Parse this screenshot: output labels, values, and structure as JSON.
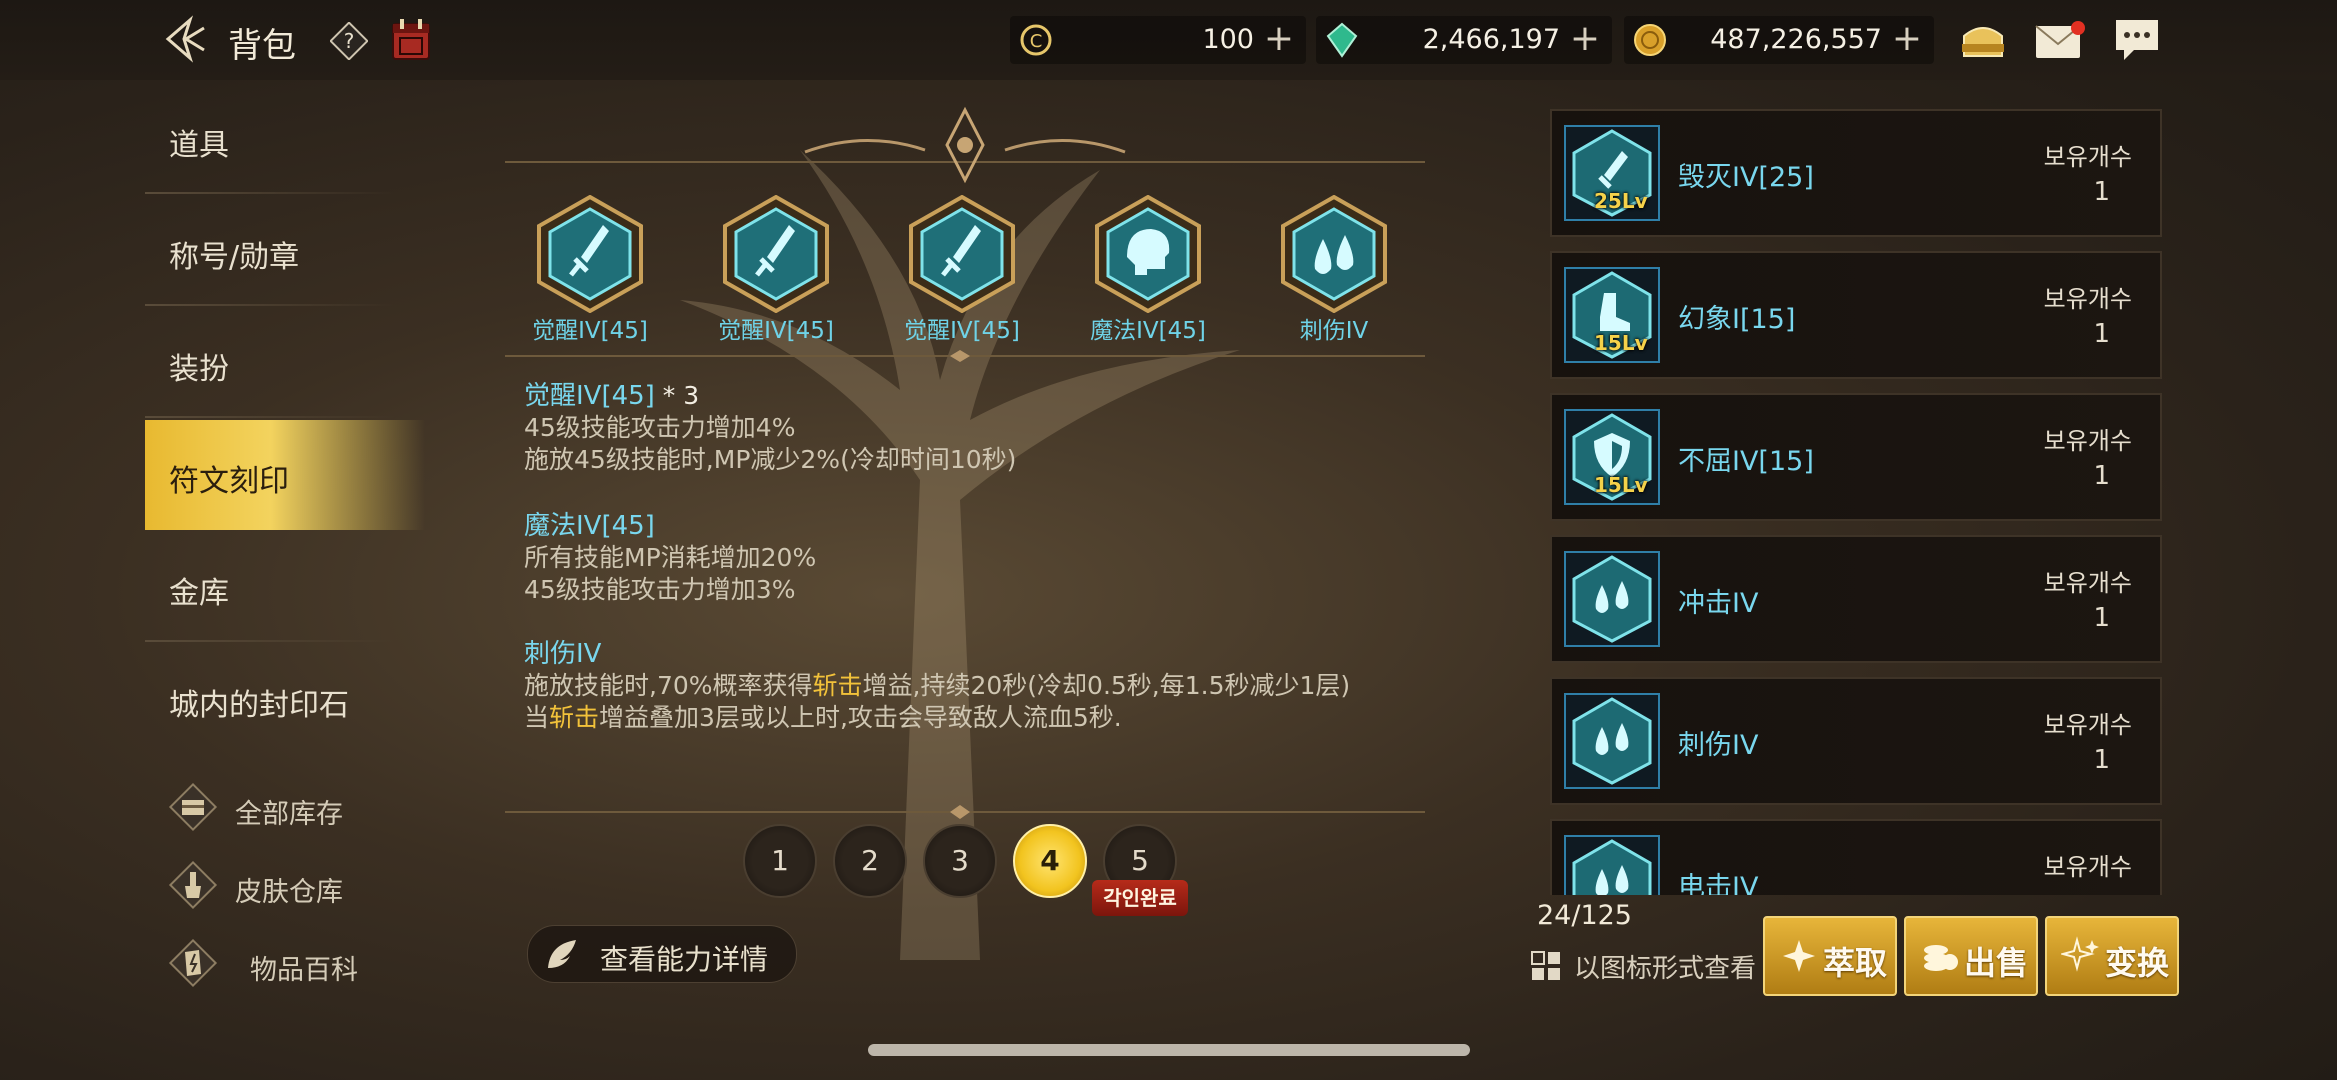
{
  "header": {
    "title": "背包",
    "currencies": [
      {
        "name": "crystal-c-currency",
        "value": "100"
      },
      {
        "name": "green-gem-currency",
        "value": "2,466,197"
      },
      {
        "name": "gold-coin-currency",
        "value": "487,226,557"
      }
    ],
    "plus_label": "+"
  },
  "sidebar": {
    "items": [
      {
        "label": "道具"
      },
      {
        "label": "称号/勋章"
      },
      {
        "label": "装扮"
      },
      {
        "label": "符文刻印"
      },
      {
        "label": "金库"
      },
      {
        "label": "城内的封印石"
      }
    ],
    "links": [
      {
        "label": "全部库存"
      },
      {
        "label": "皮肤仓库"
      },
      {
        "label": "物品百科"
      }
    ]
  },
  "slots": [
    {
      "name": "觉醒IV[45]",
      "icon": "sword-icon"
    },
    {
      "name": "觉醒IV[45]",
      "icon": "sword-icon"
    },
    {
      "name": "觉醒IV[45]",
      "icon": "sword-icon"
    },
    {
      "name": "魔法IV[45]",
      "icon": "head-icon"
    },
    {
      "name": "刺伤IV",
      "icon": "drops-icon"
    }
  ],
  "effects": [
    {
      "title": "觉醒IV[45]",
      "mult": " * 3",
      "line1": "45级技能攻击力增加4%",
      "line2": "施放45级技能时,MP减少2%(冷却时间10秒)"
    },
    {
      "title": "魔法IV[45]",
      "line1": "所有技能MP消耗增加20%",
      "line2": "45级技能攻击力增加3%"
    },
    {
      "title": "刺伤IV",
      "l1a": "施放技能时,70%概率获得",
      "l1b": "斩击",
      "l1c": "增益,持续20秒(冷却0.5秒,每1.5秒减少1层)",
      "l2a": "当",
      "l2b": "斩击",
      "l2c": "增益叠加3层或以上时,攻击会导致敌人流血5秒."
    }
  ],
  "pages": [
    "1",
    "2",
    "3",
    "4",
    "5"
  ],
  "active_page": "4",
  "engrave_badge": "각인완료",
  "detail_button": "查看能力详情",
  "inventory": {
    "on_hand_label": "보유개수",
    "items": [
      {
        "name": "毁灭IV[25]",
        "level": "25Lv",
        "count": "1",
        "icon": "sword-icon"
      },
      {
        "name": "幻象I[15]",
        "level": "15Lv",
        "count": "1",
        "icon": "boot-icon"
      },
      {
        "name": "不屈IV[15]",
        "level": "15Lv",
        "count": "1",
        "icon": "shield-icon"
      },
      {
        "name": "冲击IV",
        "level": "",
        "count": "1",
        "icon": "drops-icon"
      },
      {
        "name": "刺伤IV",
        "level": "",
        "count": "1",
        "icon": "drops-icon"
      },
      {
        "name": "电击IV",
        "level": "",
        "count": "",
        "icon": "drops-icon"
      }
    ],
    "count_text": "24/125",
    "view_toggle": "以图标形式查看"
  },
  "actions": [
    {
      "label": "萃取",
      "icon": "extract-icon"
    },
    {
      "label": "出售",
      "icon": "coins-icon"
    },
    {
      "label": "变换",
      "icon": "sparkle-icon"
    }
  ],
  "colors": {
    "accent_gold": "#f2c23a",
    "rune_cyan": "#79d7ee",
    "badge_red": "#b62b1a"
  }
}
